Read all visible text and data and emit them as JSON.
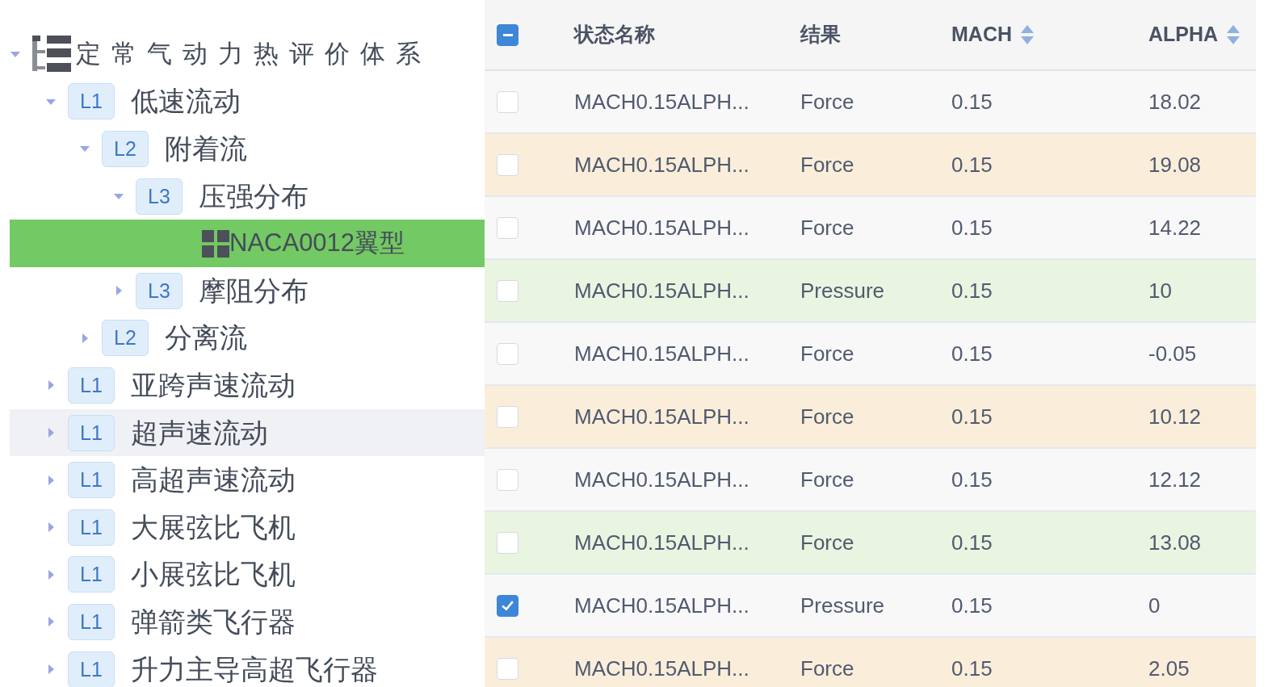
{
  "tree": {
    "label": "定常气动力热评价体系",
    "expanded": true,
    "children": [
      {
        "tag": "L1",
        "label": "低速流动",
        "expanded": true,
        "selected": false,
        "hovered": false,
        "children": [
          {
            "tag": "L2",
            "label": "附着流",
            "expanded": true,
            "selected": false,
            "hovered": false,
            "children": [
              {
                "tag": "L3",
                "label": "压强分布",
                "expanded": true,
                "selected": false,
                "hovered": false,
                "children": [
                  {
                    "kind": "leaf",
                    "label": "NACA0012翼型",
                    "selected": true
                  }
                ]
              },
              {
                "tag": "L3",
                "label": "摩阻分布",
                "expanded": false,
                "selected": false,
                "hovered": false
              }
            ]
          },
          {
            "tag": "L2",
            "label": "分离流",
            "expanded": false,
            "selected": false,
            "hovered": false
          }
        ]
      },
      {
        "tag": "L1",
        "label": "亚跨声速流动",
        "expanded": false,
        "selected": false,
        "hovered": false
      },
      {
        "tag": "L1",
        "label": "超声速流动",
        "expanded": false,
        "selected": false,
        "hovered": true
      },
      {
        "tag": "L1",
        "label": "高超声速流动",
        "expanded": false,
        "selected": false,
        "hovered": false
      },
      {
        "tag": "L1",
        "label": "大展弦比飞机",
        "expanded": false,
        "selected": false,
        "hovered": false
      },
      {
        "tag": "L1",
        "label": "小展弦比飞机",
        "expanded": false,
        "selected": false,
        "hovered": false
      },
      {
        "tag": "L1",
        "label": "弹箭类飞行器",
        "expanded": false,
        "selected": false,
        "hovered": false
      },
      {
        "tag": "L1",
        "label": "升力主导高超飞行器",
        "expanded": false,
        "selected": false,
        "hovered": false
      }
    ]
  },
  "table": {
    "select_all": {
      "indeterminate": true
    },
    "columns": [
      {
        "label": "状态名称"
      },
      {
        "label": "结果"
      },
      {
        "label": "MACH",
        "sortable": true
      },
      {
        "label": "ALPHA",
        "sortable": true
      }
    ],
    "rows": [
      {
        "color": "#f8f8f9",
        "checked": false,
        "cells": [
          "MACH0.15ALPH...",
          "Force",
          "0.15",
          "18.02"
        ]
      },
      {
        "color": "#faeedb",
        "checked": false,
        "cells": [
          "MACH0.15ALPH...",
          "Force",
          "0.15",
          "19.08"
        ]
      },
      {
        "color": "#f8f8f9",
        "checked": false,
        "cells": [
          "MACH0.15ALPH...",
          "Force",
          "0.15",
          "14.22"
        ]
      },
      {
        "color": "#e9f5e1",
        "checked": false,
        "cells": [
          "MACH0.15ALPH...",
          "Pressure",
          "0.15",
          "10"
        ]
      },
      {
        "color": "#f8f8f9",
        "checked": false,
        "cells": [
          "MACH0.15ALPH...",
          "Force",
          "0.15",
          "-0.05"
        ]
      },
      {
        "color": "#faeedb",
        "checked": false,
        "cells": [
          "MACH0.15ALPH...",
          "Force",
          "0.15",
          "10.12"
        ]
      },
      {
        "color": "#f8f8f9",
        "checked": false,
        "cells": [
          "MACH0.15ALPH...",
          "Force",
          "0.15",
          "12.12"
        ]
      },
      {
        "color": "#e9f5e1",
        "checked": false,
        "cells": [
          "MACH0.15ALPH...",
          "Force",
          "0.15",
          "13.08"
        ]
      },
      {
        "color": "#f8f8f9",
        "checked": true,
        "cells": [
          "MACH0.15ALPH...",
          "Pressure",
          "0.15",
          "0"
        ]
      },
      {
        "color": "#faeedb",
        "checked": false,
        "cells": [
          "MACH0.15ALPH...",
          "Force",
          "0.15",
          "2.05"
        ]
      }
    ]
  }
}
